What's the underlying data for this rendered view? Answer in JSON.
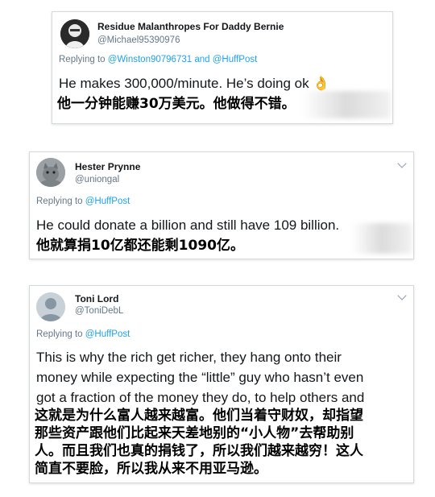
{
  "tweets": [
    {
      "name": "Residue Malanthropes For Daddy Bernie",
      "handle": "@Michael95390976",
      "replying_prefix": "Replying to",
      "replying_mention1": "@Winston90796731",
      "replying_and": "and",
      "replying_mention2": "@HuffPost",
      "body": "He makes 300,000/minute. He’s doing ok 👌",
      "translation": "他一分钟能赚30万美元。他做得不错。"
    },
    {
      "name": "Hester Prynne",
      "handle": "@uniongal",
      "replying_prefix": "Replying to",
      "replying_mention1": "@HuffPost",
      "body": "He could donate a billion and still have 109 billion.",
      "translation": "他就算捐10亿都还能剩1090亿。"
    },
    {
      "name": "Toni Lord",
      "handle": "@ToniDebL",
      "replying_prefix": "Replying to",
      "replying_mention1": "@HuffPost",
      "body_lines": [
        "This is why the rich get richer, they hang onto their",
        "money while expecting the “little” guy who hasn’t even",
        "got a fraction of the money they do, to help others and"
      ],
      "translation_lines": [
        "这就是为什么富人越来越富。他们当着守财奴，却指望",
        "那些资产跟他们比起来天差地别的“小人物”去帮助别",
        "人。而且我们也真的捐钱了，所以我们越来越穷！这人",
        "简直不要脸，所以我从来不用亚马逊。"
      ]
    }
  ],
  "colors": {
    "link": "#1da1f2",
    "secondary": "#657786",
    "text": "#14171a",
    "border": "#d4d9de"
  },
  "icons": {
    "menu": "chevron-down-icon",
    "ok_hand": "ok-hand-emoji",
    "avatar3": "default-profile-icon"
  }
}
